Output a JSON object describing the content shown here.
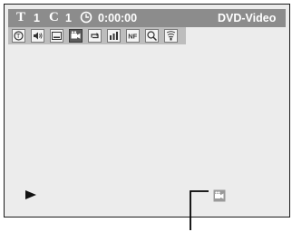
{
  "info_bar": {
    "title_label": "T",
    "title_number": "1",
    "chapter_label": "C",
    "chapter_number": "1",
    "time_icon": "clock-icon",
    "elapsed_time": "0:00:00",
    "disc_type": "DVD-Video"
  },
  "icon_bar": {
    "icons": [
      {
        "name": "title-select-icon",
        "selected": false
      },
      {
        "name": "audio-icon",
        "selected": false
      },
      {
        "name": "subtitle-icon",
        "selected": false
      },
      {
        "name": "angle-icon",
        "selected": true
      },
      {
        "name": "repeat-icon",
        "selected": false
      },
      {
        "name": "bookmark-icon",
        "selected": false
      },
      {
        "name": "nf-icon",
        "label": "NF",
        "selected": false
      },
      {
        "name": "zoom-icon",
        "selected": false
      },
      {
        "name": "sound-effect-icon",
        "selected": false
      }
    ]
  },
  "playback": {
    "state_icon": "play-icon"
  },
  "indicator": {
    "icon": "angle-icon"
  },
  "colors": {
    "screen_bg": "#ececec",
    "info_bar_bg": "#8c8c8c",
    "icon_bar_bg": "#bdbdbd",
    "selected_icon_bg": "#5c5c5c"
  }
}
